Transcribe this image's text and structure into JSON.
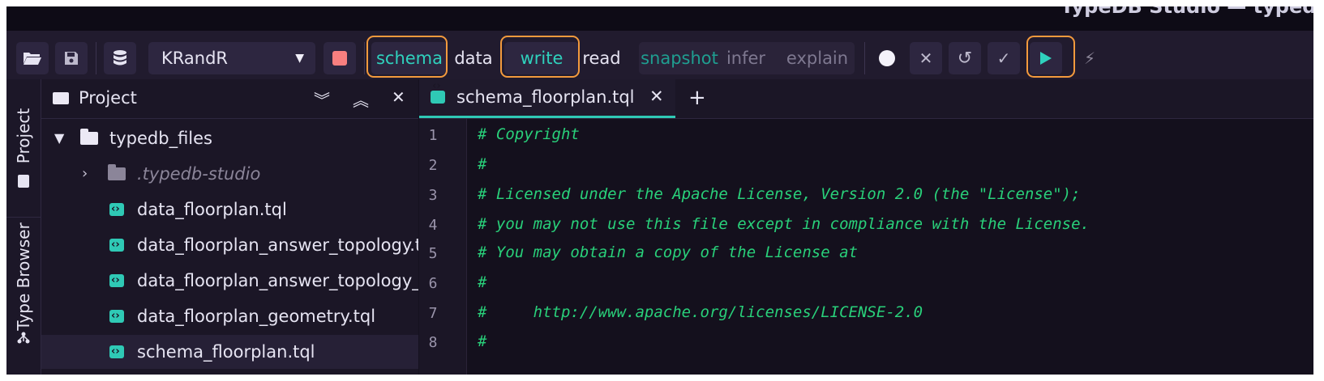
{
  "window": {
    "title": "TypeDB Studio — typedb"
  },
  "toolbar": {
    "open_icon": "folder-open-icon",
    "save_icon": "save-icon",
    "database_icon": "database-icon",
    "database": {
      "selected": "KRandR"
    },
    "session_type": {
      "options": [
        "schema",
        "data"
      ],
      "selected": "schema"
    },
    "transaction_type": {
      "options": [
        "write",
        "read"
      ],
      "selected": "write"
    },
    "options": {
      "snapshot": "snapshot",
      "infer": "infer",
      "explain": "explain"
    },
    "actions": [
      "status-circle-icon",
      "close-icon",
      "rollback-icon",
      "commit-icon",
      "run-icon",
      "stop-signal-icon"
    ],
    "highlight_color": "#f39a3d",
    "accent_color": "#2fd1bd"
  },
  "sidebar": {
    "tabs": [
      {
        "label": "Project",
        "icon": "project-icon"
      },
      {
        "label": "Type Browser",
        "icon": "hierarchy-icon"
      }
    ]
  },
  "project": {
    "title": "Project",
    "header_icons": [
      "expand-all-icon",
      "collapse-all-icon",
      "close-icon"
    ],
    "tree": [
      {
        "label": "typedb_files",
        "kind": "folder",
        "expanded": true
      },
      {
        "label": ".typedb-studio",
        "kind": "folder",
        "expanded": false
      },
      {
        "label": "data_floorplan.tql",
        "kind": "file"
      },
      {
        "label": "data_floorplan_answer_topology.tql",
        "kind": "file"
      },
      {
        "label": "data_floorplan_answer_topology_an",
        "kind": "file"
      },
      {
        "label": "data_floorplan_geometry.tql",
        "kind": "file"
      },
      {
        "label": "schema_floorplan.tql",
        "kind": "file",
        "selected": true
      }
    ]
  },
  "editor": {
    "tabs": [
      {
        "label": "schema_floorplan.tql",
        "active": true
      }
    ],
    "new_tab_label": "+",
    "line_numbers": [
      "1",
      "2",
      "3",
      "4",
      "5",
      "6",
      "7",
      "8"
    ],
    "lines": [
      "# Copyright",
      "#",
      "# Licensed under the Apache License, Version 2.0 (the \"License\");",
      "# you may not use this file except in compliance with the License.",
      "# You may obtain a copy of the License at",
      "#",
      "#     http://www.apache.org/licenses/LICENSE-2.0",
      "#"
    ]
  }
}
